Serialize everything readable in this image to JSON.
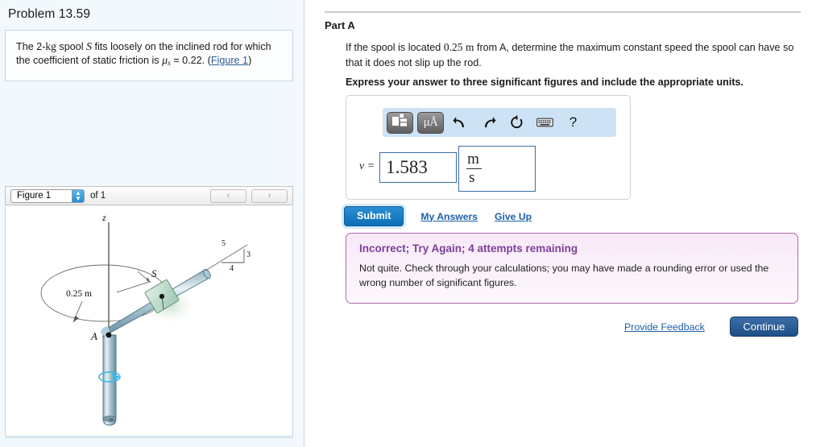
{
  "left": {
    "problem_title": "Problem 13.59",
    "statement": {
      "part1": "The 2-",
      "unit_kg": "kg",
      "part2": " spool ",
      "var_S": "S",
      "part3": " fits loosely on the inclined rod for which the coefficient of static friction is ",
      "mu": "μ",
      "mu_sub": "s",
      "eq": " = 0.22. (",
      "link": "Figure 1",
      "close": ")"
    },
    "figure_nav": {
      "select_value": "Figure 1",
      "of_label": "of 1",
      "prev_icon": "‹",
      "next_icon": "›"
    },
    "figure": {
      "axis_label_z": "z",
      "point_A": "A",
      "point_S": "S",
      "dimension": "0.25 m",
      "slope_hyp": "5",
      "slope_vert": "3",
      "slope_horiz": "4"
    }
  },
  "right": {
    "part_heading": "Part A",
    "question": "If the spool is located 0.25 m from A, determine the maximum constant speed the spool can have so that it does not slip up the rod.",
    "question_value": "0.25",
    "question_unit": "m",
    "question_pre": "If the spool is located ",
    "question_post": " from A, determine the maximum constant speed the spool can have so that it does not slip up the rod.",
    "instruction": "Express your answer to three significant figures and include the appropriate units.",
    "answer": {
      "variable": "v =",
      "value": "1.583",
      "unit_numerator": "m",
      "unit_denominator": "s"
    },
    "toolbar": {
      "template_icon": "template-icon",
      "units_label": "μÅ",
      "undo_icon": "↶",
      "redo_icon": "↷",
      "reset_icon": "↺",
      "keyboard_icon": "keyboard-icon",
      "help_icon": "?"
    },
    "actions": {
      "submit": "Submit",
      "my_answers": "My Answers",
      "give_up": "Give Up"
    },
    "feedback": {
      "title": "Incorrect; Try Again; 4 attempts remaining",
      "body": "Not quite. Check through your calculations; you may have made a rounding error or used the wrong number of significant figures."
    },
    "footer": {
      "provide_feedback": "Provide Feedback",
      "continue": "Continue"
    }
  },
  "colors": {
    "panel_bg": "#f3f8fc",
    "link": "#1d5fa8",
    "submit": "#0c6fb8",
    "feedback_border": "#b06ab0",
    "feedback_title": "#7b3f98",
    "toolbar_bg": "#cde3f5"
  }
}
